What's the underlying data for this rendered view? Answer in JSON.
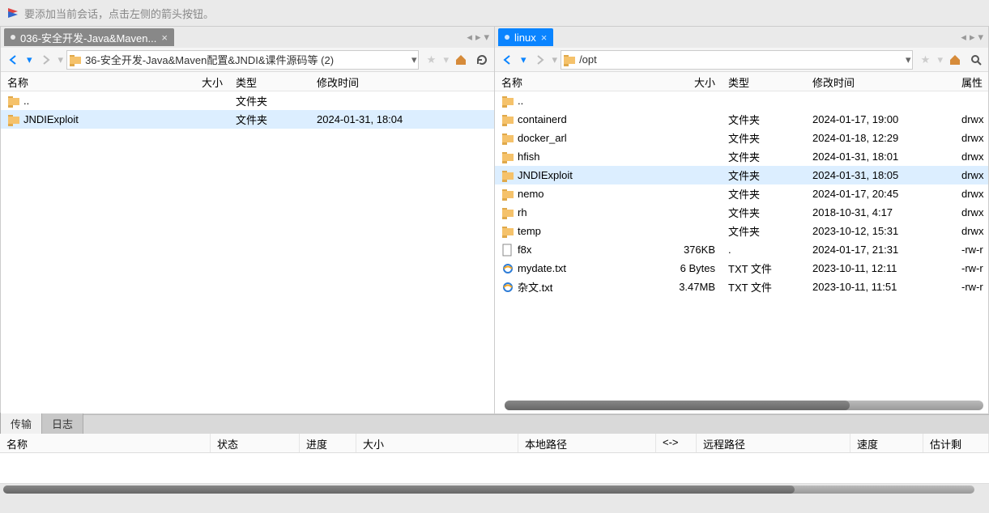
{
  "hint": "要添加当前会话，点击左侧的箭头按钮。",
  "left": {
    "tab": "036-安全开发-Java&Maven...",
    "path": "36-安全开发-Java&Maven配置&JNDI&课件源码等 (2)",
    "cols": {
      "name": "名称",
      "size": "大小",
      "type": "类型",
      "mod": "修改时间"
    },
    "rows": [
      {
        "name": "..",
        "size": "",
        "type": "文件夹",
        "mod": "",
        "icon": "folder",
        "sel": false
      },
      {
        "name": "JNDIExploit",
        "size": "",
        "type": "文件夹",
        "mod": "2024-01-31, 18:04",
        "icon": "folder",
        "sel": true
      }
    ]
  },
  "right": {
    "tab": "linux",
    "path": "/opt",
    "cols": {
      "name": "名称",
      "size": "大小",
      "type": "类型",
      "mod": "修改时间",
      "attr": "属性"
    },
    "rows": [
      {
        "name": "..",
        "size": "",
        "type": "",
        "mod": "",
        "attr": "",
        "icon": "folder",
        "sel": false
      },
      {
        "name": "containerd",
        "size": "",
        "type": "文件夹",
        "mod": "2024-01-17, 19:00",
        "attr": "drwx",
        "icon": "folder",
        "sel": false
      },
      {
        "name": "docker_arl",
        "size": "",
        "type": "文件夹",
        "mod": "2024-01-18, 12:29",
        "attr": "drwx",
        "icon": "folder",
        "sel": false
      },
      {
        "name": "hfish",
        "size": "",
        "type": "文件夹",
        "mod": "2024-01-31, 18:01",
        "attr": "drwx",
        "icon": "folder",
        "sel": false
      },
      {
        "name": "JNDIExploit",
        "size": "",
        "type": "文件夹",
        "mod": "2024-01-31, 18:05",
        "attr": "drwx",
        "icon": "folder",
        "sel": true
      },
      {
        "name": "nemo",
        "size": "",
        "type": "文件夹",
        "mod": "2024-01-17, 20:45",
        "attr": "drwx",
        "icon": "folder",
        "sel": false
      },
      {
        "name": "rh",
        "size": "",
        "type": "文件夹",
        "mod": "2018-10-31, 4:17",
        "attr": "drwx",
        "icon": "folder",
        "sel": false
      },
      {
        "name": "temp",
        "size": "",
        "type": "文件夹",
        "mod": "2023-10-12, 15:31",
        "attr": "drwx",
        "icon": "folder",
        "sel": false
      },
      {
        "name": "f8x",
        "size": "376KB",
        "type": ".",
        "mod": "2024-01-17, 21:31",
        "attr": "-rw-r",
        "icon": "file",
        "sel": false
      },
      {
        "name": "mydate.txt",
        "size": "6 Bytes",
        "type": "TXT 文件",
        "mod": "2023-10-11, 12:11",
        "attr": "-rw-r",
        "icon": "ie",
        "sel": false
      },
      {
        "name": "杂文.txt",
        "size": "3.47MB",
        "type": "TXT 文件",
        "mod": "2023-10-11, 11:51",
        "attr": "-rw-r",
        "icon": "ie",
        "sel": false
      }
    ]
  },
  "bottomTabs": {
    "transfer": "传输",
    "log": "日志"
  },
  "transferCols": {
    "name": "名称",
    "status": "状态",
    "progress": "进度",
    "size": "大小",
    "local": "本地路径",
    "dir": "<->",
    "remote": "远程路径",
    "speed": "速度",
    "eta": "估计剩"
  }
}
